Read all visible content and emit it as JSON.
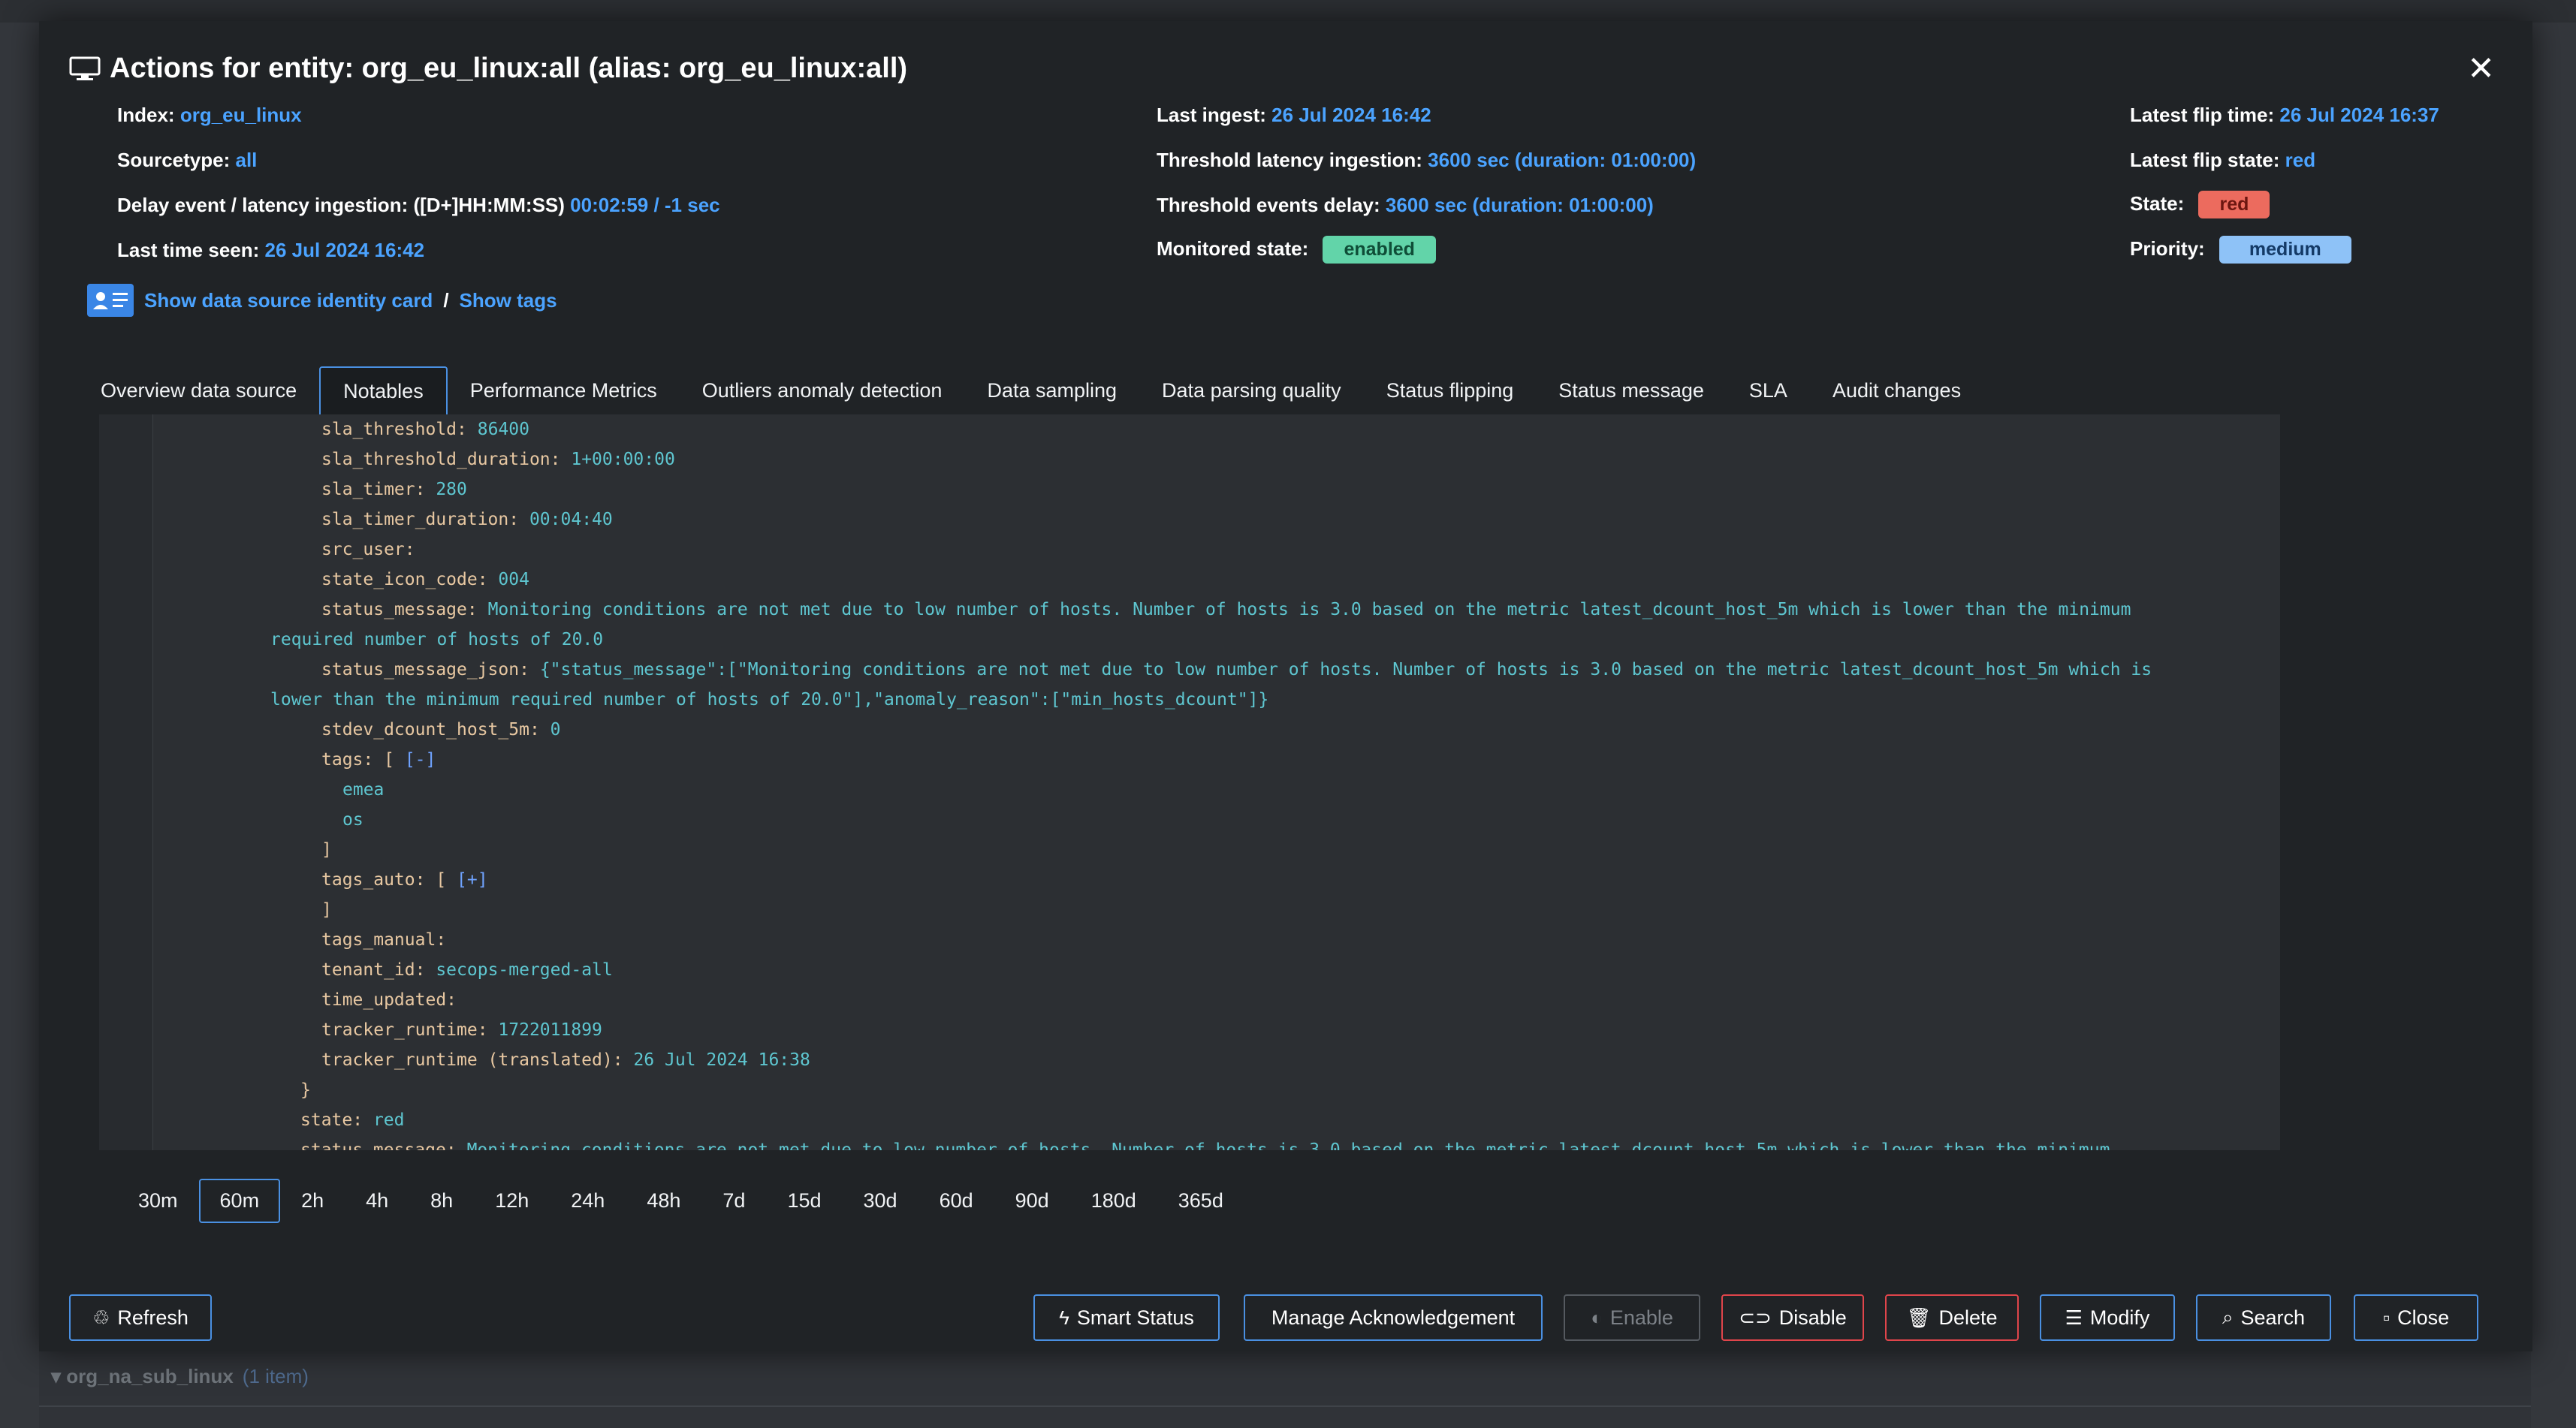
{
  "modal": {
    "title": "Actions for entity: org_eu_linux:all (alias: org_eu_linux:all)",
    "close_glyph": "✕"
  },
  "meta": {
    "index_label": "Index:",
    "index_value": "org_eu_linux",
    "sourcetype_label": "Sourcetype:",
    "sourcetype_value": "all",
    "delay_label": "Delay event / latency ingestion: ([D+]HH:MM:SS)",
    "delay_value": "00:02:59 / -1 sec",
    "last_seen_label": "Last time seen:",
    "last_seen_value": "26 Jul 2024 16:42",
    "last_ingest_label": "Last ingest:",
    "last_ingest_value": "26 Jul 2024 16:42",
    "thr_latency_label": "Threshold latency ingestion:",
    "thr_latency_value": "3600 sec (duration: 01:00:00)",
    "thr_delay_label": "Threshold events delay:",
    "thr_delay_value": "3600 sec (duration: 01:00:00)",
    "monitored_label": "Monitored state:",
    "monitored_value": "enabled",
    "flip_time_label": "Latest flip time:",
    "flip_time_value": "26 Jul 2024 16:37",
    "flip_state_label": "Latest flip state:",
    "flip_state_value": "red",
    "state_label": "State:",
    "state_value": "red",
    "priority_label": "Priority:",
    "priority_value": "medium"
  },
  "links": {
    "identity_card": "Show data source identity card",
    "separator": "/",
    "tags": "Show tags"
  },
  "tabs": [
    {
      "label": "Overview data source"
    },
    {
      "label": "Notables"
    },
    {
      "label": "Performance Metrics"
    },
    {
      "label": "Outliers anomaly detection"
    },
    {
      "label": "Data sampling"
    },
    {
      "label": "Data parsing quality"
    },
    {
      "label": "Status flipping"
    },
    {
      "label": "Status message"
    },
    {
      "label": "SLA"
    },
    {
      "label": "Audit changes"
    }
  ],
  "code": {
    "l1_k": "sla_threshold",
    "l1_v": "86400",
    "l2_k": "sla_threshold_duration",
    "l2_v": "1+00:00:00",
    "l3_k": "sla_timer",
    "l3_v": "280",
    "l4_k": "sla_timer_duration",
    "l4_v": "00:04:40",
    "l5_k": "src_user",
    "l6_k": "state_icon_code",
    "l6_v": "004",
    "l7_k": "status_message",
    "l7_v": "Monitoring conditions are not met due to low number of hosts. Number of hosts is 3.0 based on the metric latest_dcount_host_5m which is lower than the minimum",
    "l7_cont": "required number of hosts of 20.0",
    "l8_k": "status_message_json",
    "l8_v": "{\"status_message\":[\"Monitoring conditions are not met due to low number of hosts. Number of hosts is 3.0 based on the metric latest_dcount_host_5m which is",
    "l8_cont": "lower than the minimum required number of hosts of 20.0\"],\"anomaly_reason\":[\"min_hosts_dcount\"]}",
    "l9_k": "stdev_dcount_host_5m",
    "l9_v": "0",
    "l10_k": "tags",
    "l10_open": "[",
    "l10_tog": "[-]",
    "l11_v": "emea",
    "l12_v": "os",
    "l13_close": "]",
    "l14_k": "tags_auto",
    "l14_open": "[",
    "l14_tog": "[+]",
    "l15_close": "]",
    "l16_k": "tags_manual",
    "l17_k": "tenant_id",
    "l17_v": "secops-merged-all",
    "l18_k": "time_updated",
    "l19_k": "tracker_runtime",
    "l19_v": "1722011899",
    "l20_k": "tracker_runtime (translated)",
    "l20_v": "26 Jul 2024 16:38",
    "l21_close": "}",
    "l22_k": "state",
    "l22_v": "red",
    "l23_k": "status_message",
    "l23_v": "Monitoring conditions are not met due to low number of hosts. Number of hosts is 3.0 based on the metric latest_dcount_host_5m which is lower than the minimum"
  },
  "ranges": [
    "30m",
    "60m",
    "2h",
    "4h",
    "8h",
    "12h",
    "24h",
    "48h",
    "7d",
    "15d",
    "30d",
    "60d",
    "90d",
    "180d",
    "365d"
  ],
  "buttons": {
    "refresh": "Refresh",
    "smart_status": "Smart Status",
    "manage_ack": "Manage Acknowledgement",
    "enable": "Enable",
    "disable": "Disable",
    "delete": "Delete",
    "modify": "Modify",
    "search": "Search",
    "close": "Close"
  },
  "background": {
    "group_label": "org_na_sub_linux",
    "group_count": "(1 item)"
  },
  "colors": {
    "accent": "#4a90e2",
    "link": "#4ba3ff",
    "state_red": "#ec6b5e",
    "enabled_green": "#62d4a9",
    "priority_medium": "#8ec2f7",
    "highlight": "#c3e23a"
  }
}
